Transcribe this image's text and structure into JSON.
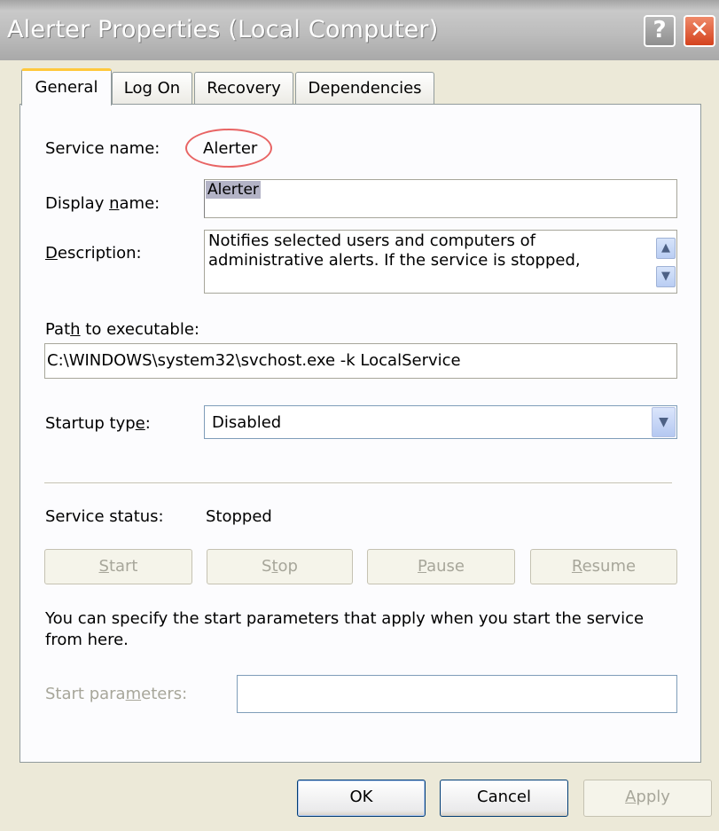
{
  "window": {
    "title": "Alerter Properties (Local Computer)",
    "help_glyph": "?",
    "close_glyph": "✕"
  },
  "tabs": [
    "General",
    "Log On",
    "Recovery",
    "Dependencies"
  ],
  "general": {
    "service_name_label": "Service name:",
    "service_name_value": "Alerter",
    "display_name_label_pre": "Display ",
    "display_name_label_key": "n",
    "display_name_label_post": "ame:",
    "display_name_value": "Alerter",
    "description_label_key": "D",
    "description_label_post": "escription:",
    "description_line1": "Notifies selected users and computers of",
    "description_line2": "administrative alerts. If the service is stopped,",
    "path_label_pre": "Pat",
    "path_label_key": "h",
    "path_label_post": " to executable:",
    "path_value": "C:\\WINDOWS\\system32\\svchost.exe -k LocalService",
    "startup_label_pre": "Startup typ",
    "startup_label_key": "e",
    "startup_label_post": ":",
    "startup_value": "Disabled",
    "status_label": "Service status:",
    "status_value": "Stopped",
    "buttons": {
      "start_key": "S",
      "start_post": "tart",
      "stop_pre": "S",
      "stop_key": "t",
      "stop_post": "op",
      "pause_key": "P",
      "pause_post": "ause",
      "resume_key": "R",
      "resume_post": "esume"
    },
    "hint": "You can specify the start parameters that apply when you start the service from here.",
    "params_label_pre": "Start para",
    "params_label_key": "m",
    "params_label_post": "eters:",
    "params_value": ""
  },
  "footer": {
    "ok": "OK",
    "cancel": "Cancel",
    "apply_key": "A",
    "apply_post": "pply"
  },
  "colors": {
    "highlight_oval": "#e86464",
    "active_tab_accent": "#ffc83c",
    "disabled_text": "#a7a69a"
  }
}
